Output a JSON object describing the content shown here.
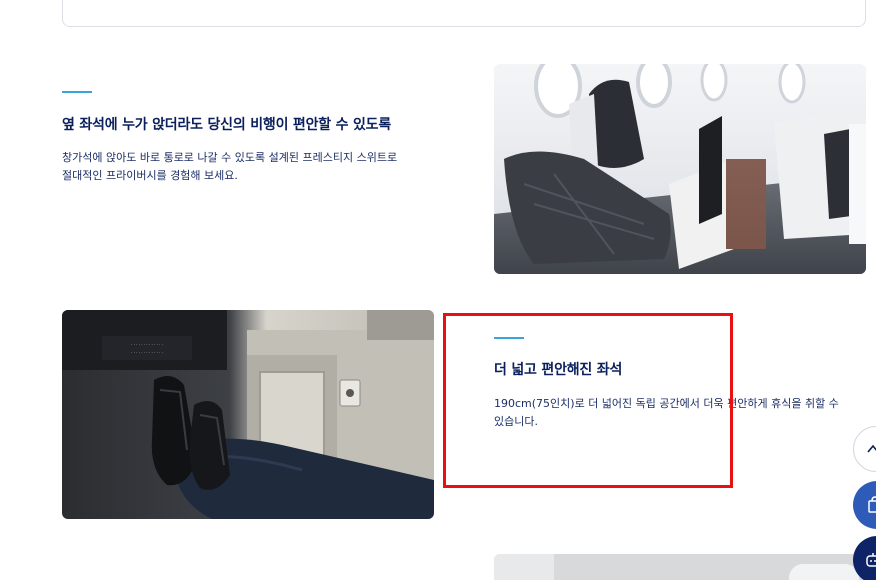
{
  "features": [
    {
      "title": "옆 좌석에 누가 앉더라도 당신의 비행이 편안할 수 있도록",
      "desc_line1": "창가석에 앉아도 바로 통로로 나갈 수 있도록 설계된 프레스티지 스위트로",
      "desc_line2": "절대적인 프라이버시를 경험해 보세요."
    },
    {
      "title": "더 넓고 편안해진 좌석",
      "desc_line1": "190cm(75인치)로 더 넓어진 독립 공간에서 더욱 편안하게 휴식을 취할 수",
      "desc_line2": "있습니다."
    }
  ],
  "accent_color": "#3aa3d8",
  "title_color": "#0a1f5c",
  "highlight_color": "#e8110f",
  "float_buttons": {
    "top_icon": "chevron-up-icon",
    "cart_icon": "shopping-bag-icon",
    "chat_icon": "chatbot-icon"
  }
}
